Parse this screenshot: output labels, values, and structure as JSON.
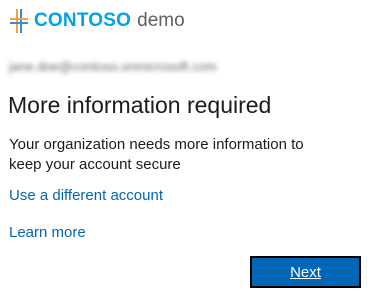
{
  "brand": {
    "name": "CONTOSO",
    "suffix": "demo",
    "logo_icon": "contoso-cross-logo-icon",
    "colors": {
      "orange": "#f2a23c",
      "blue": "#2e8fd6",
      "brand_text": "#00a2ed"
    }
  },
  "account": {
    "email": "jane.doe@contoso.onmicrosoft.com",
    "obscured": true
  },
  "page": {
    "title": "More information required",
    "description": "Your organization needs more information to keep your account secure"
  },
  "links": {
    "different_account": "Use a different account",
    "learn_more": "Learn more"
  },
  "buttons": {
    "next": "Next"
  },
  "colors": {
    "accent": "#0067b8",
    "text": "#1b1b1b",
    "button_border": "#000000"
  }
}
